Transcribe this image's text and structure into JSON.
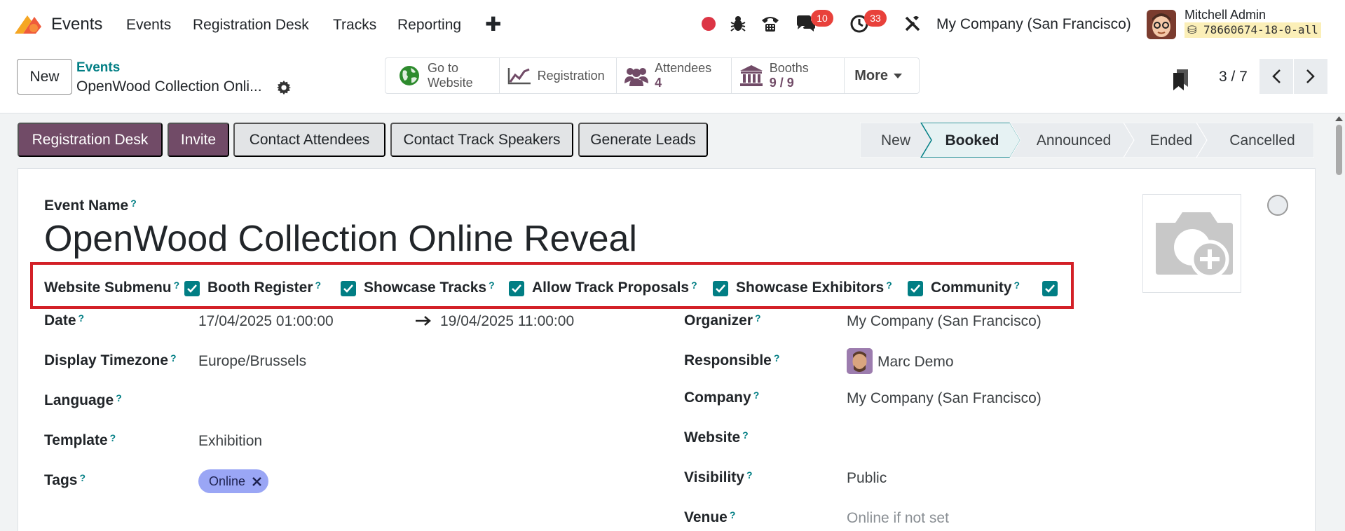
{
  "navbar": {
    "app_name": "Events",
    "menus": [
      "Events",
      "Registration Desk",
      "Tracks",
      "Reporting"
    ],
    "plus": "✚",
    "messages_count": "10",
    "activities_count": "33",
    "company": "My Company (San Francisco)",
    "user_name": "Mitchell Admin",
    "database": "78660674-18-0-all"
  },
  "control": {
    "new_label": "New",
    "breadcrumb_parent": "Events",
    "breadcrumb_current": "OpenWood Collection Onli...",
    "smart_buttons": {
      "go_to_website_1": "Go to",
      "go_to_website_2": "Website",
      "registration": "Registration",
      "attendees_label": "Attendees",
      "attendees_value": "4",
      "booths_label": "Booths",
      "booths_value": "9 / 9",
      "more": "More"
    },
    "pager": "3 / 7"
  },
  "actions": {
    "registration_desk": "Registration Desk",
    "invite": "Invite",
    "contact_attendees": "Contact Attendees",
    "contact_track_speakers": "Contact Track Speakers",
    "generate_leads": "Generate Leads"
  },
  "stages": {
    "items": [
      "New",
      "Booked",
      "Announced",
      "Ended",
      "Cancelled"
    ],
    "current": "Booked"
  },
  "form": {
    "event_name_label": "Event Name",
    "event_name": "OpenWood Collection Online Reveal",
    "checkboxes": {
      "website_submenu": "Website Submenu",
      "booth_register": "Booth Register",
      "showcase_tracks": "Showcase Tracks",
      "allow_track_proposals": "Allow Track Proposals",
      "showcase_exhibitors": "Showcase Exhibitors",
      "community": "Community"
    },
    "date_label": "Date",
    "date_begin": "17/04/2025 01:00:00",
    "date_end": "19/04/2025 11:00:00",
    "timezone_label": "Display Timezone",
    "timezone": "Europe/Brussels",
    "language_label": "Language",
    "template_label": "Template",
    "template": "Exhibition",
    "tags_label": "Tags",
    "tag": "Online",
    "organizer_label": "Organizer",
    "organizer": "My Company (San Francisco)",
    "responsible_label": "Responsible",
    "responsible": "Marc Demo",
    "company_label": "Company",
    "company": "My Company (San Francisco)",
    "website_label": "Website",
    "visibility_label": "Visibility",
    "visibility": "Public",
    "venue_label": "Venue",
    "venue_placeholder": "Online if not set",
    "help_mark": "?"
  },
  "colors": {
    "brand": "#714b67",
    "accent": "#017e84",
    "highlight_box": "#d32027",
    "stage_active": "#e6f2f3"
  }
}
